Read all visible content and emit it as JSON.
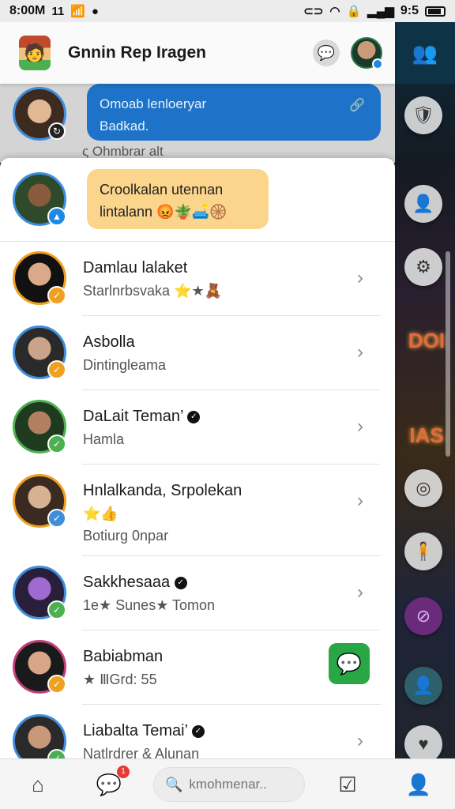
{
  "status_bar": {
    "time": "8:00M",
    "notif_icon": "11",
    "battery_text": "9:5"
  },
  "header": {
    "title": "Gnnin Rep Iragen"
  },
  "background_chat": {
    "bubble_line1": "Omoab lenloeryar",
    "bubble_line2": "Badkad.",
    "meta": "ς Ohmbrar alt"
  },
  "top_message": {
    "line1": "Croolkalan utennan",
    "line2": "lintalann 😡🪴🛋️🛞"
  },
  "contacts": [
    {
      "name": "Damlau lalaket",
      "sub": "Starlnrbsvaka ⭐★🧸",
      "verified": false
    },
    {
      "name": "Asbolla",
      "sub": "Dintingleama",
      "verified": false
    },
    {
      "name": "DaLait Teman’",
      "sub": "Hamla",
      "verified": true
    },
    {
      "name": "Hnlalkanda, Srpolekan",
      "sub": "⭐👍",
      "extra": "Botiurg 0npar",
      "verified": false
    },
    {
      "name": "Sakkhesaaa",
      "sub": "1e★ Sunes★ Tomon",
      "verified": true
    },
    {
      "name": "Babiabman",
      "sub": "★ ⅢGrd: 55",
      "verified": false
    },
    {
      "name": "Liabalta Temai’",
      "sub": "Natlrdrer & Alunan",
      "verified": true
    }
  ],
  "search": {
    "placeholder": "kmohmenar.."
  },
  "nav": {
    "chat_badge": "1"
  },
  "side_panel": {
    "art_text_1": "DOI",
    "art_text_2": "IAS"
  },
  "colors": {
    "accent_blue": "#1e73c8",
    "bubble_yellow": "#fcd58c",
    "message_green": "#29a745",
    "badge_red": "#e53935"
  },
  "icons": [
    "signal-icon",
    "wifi-icon",
    "battery-icon",
    "chat-icon",
    "chevron-right-icon",
    "home-icon",
    "messages-icon",
    "search-icon",
    "tasks-icon",
    "profile-icon"
  ]
}
